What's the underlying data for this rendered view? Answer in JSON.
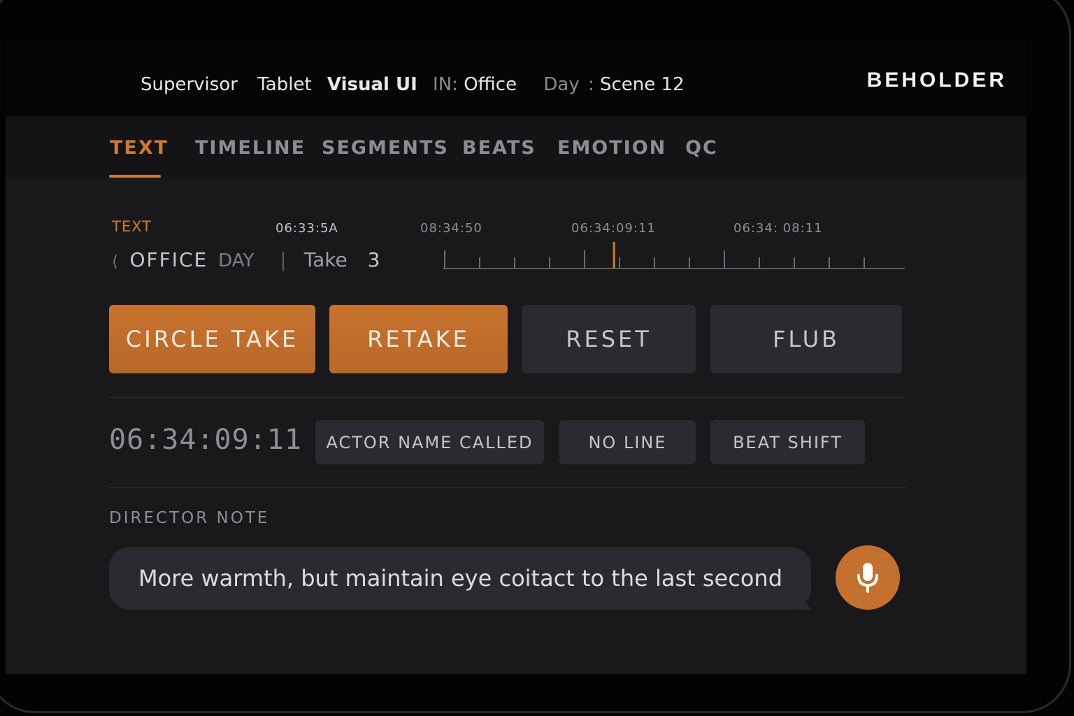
{
  "header": {
    "role": "Supervisor",
    "device": "Tablet",
    "ui_name": "Visual UI",
    "in_prefix": "IN:",
    "location": "Office",
    "day_label": "Day",
    "day_sep": ":",
    "scene_label": "Scene",
    "scene_number": "12",
    "brand": "BEHOLDER"
  },
  "tabs": [
    {
      "label": "TEXT",
      "active": true
    },
    {
      "label": "TIMELINE",
      "active": false
    },
    {
      "label": "SEGMENTS",
      "active": false
    },
    {
      "label": "BEATS",
      "active": false
    },
    {
      "label": "EMOTION",
      "active": false
    },
    {
      "label": "QC",
      "active": false
    }
  ],
  "context": {
    "section_label": "TEXT",
    "location": "OFFICE",
    "time_of_day": "DAY",
    "take_label": "Take",
    "take_number": "3"
  },
  "timeline": {
    "timecodes": [
      "06:33:5A",
      "08:34:50",
      "06:34:09:11",
      "06:34: 08:11"
    ],
    "playhead_fraction": 0.37,
    "accent": "#d07a30"
  },
  "actions": {
    "circle_take": "CIRCLE TAKE",
    "retake": "RETAKE",
    "reset": "RESET",
    "flub": "FLUB"
  },
  "current_timecode": "06:34:09:11",
  "tags": {
    "actor_name_called": "ACTOR NAME CALLED",
    "no_line": "NO LINE",
    "beat_shift": "BEAT SHIFT"
  },
  "director_note": {
    "label": "DIRECTOR  NOTE",
    "text": "More warmth, but maintain eye coitact to the last second"
  },
  "icons": {
    "mic": "microphone-icon",
    "back": "chevron-left-icon"
  },
  "colors": {
    "accent": "#d07a30",
    "background": "#19191c",
    "header": "#050505"
  }
}
